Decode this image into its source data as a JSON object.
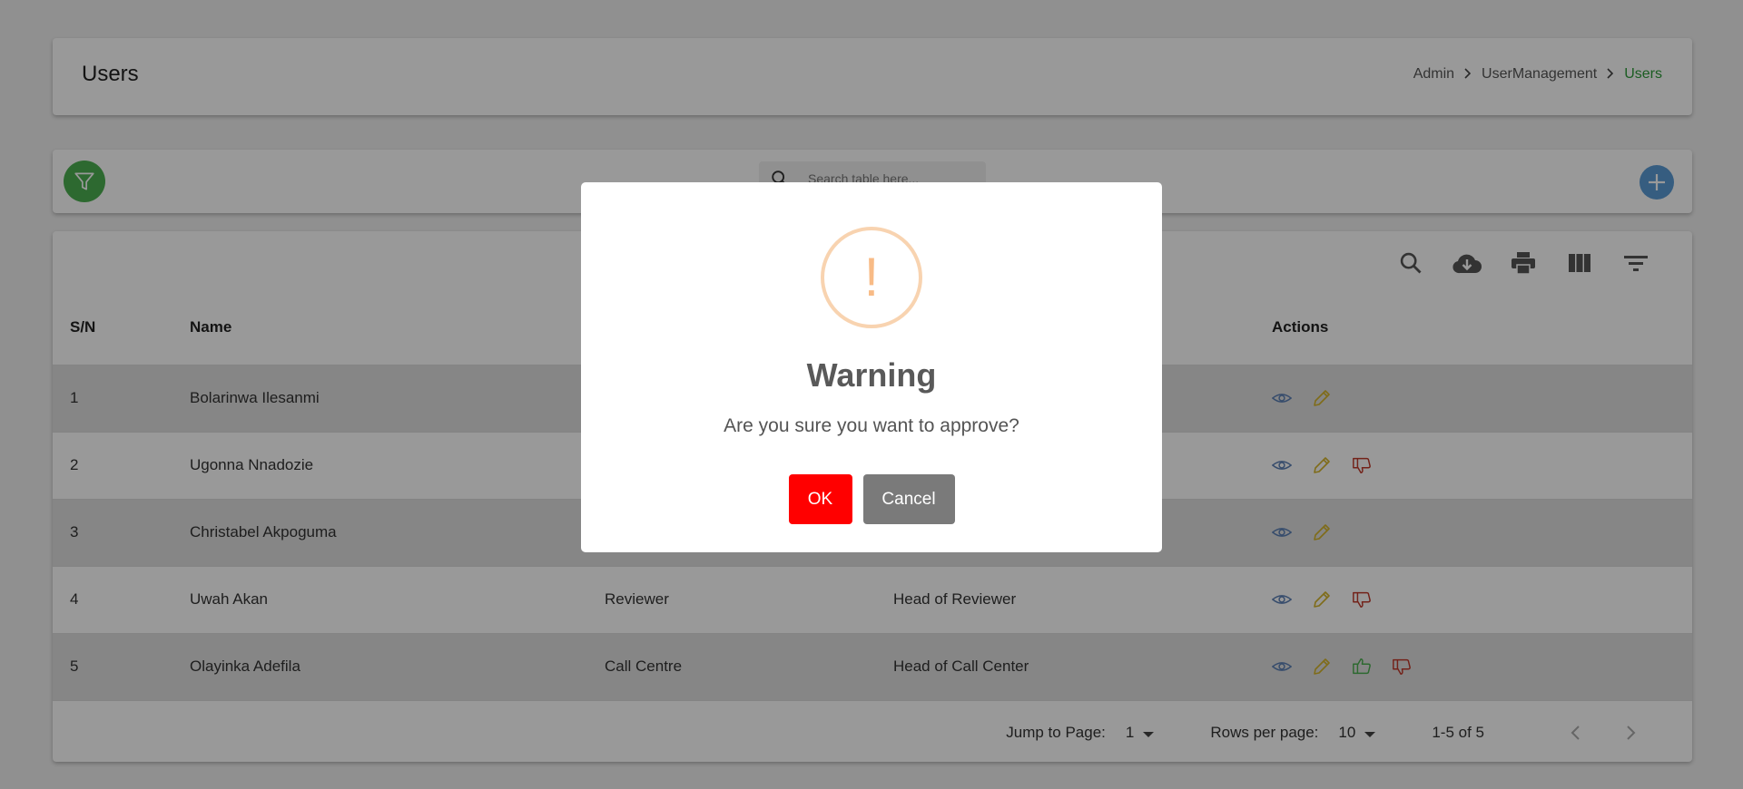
{
  "header": {
    "title": "Users",
    "breadcrumb": [
      "Admin",
      "UserManagement",
      "Users"
    ]
  },
  "toolbar": {
    "search_placeholder": "Search table here...",
    "filter_icon": "filter-icon",
    "add_icon": "plus-icon"
  },
  "table": {
    "tool_icons": [
      "search-icon",
      "cloud-download-icon",
      "print-icon",
      "columns-icon",
      "filter-list-icon"
    ],
    "columns": {
      "sn": "S/N",
      "name": "Name",
      "actions": "Actions"
    },
    "rows": [
      {
        "sn": "1",
        "name": "Bolarinwa Ilesanmi",
        "role": "",
        "designation": "",
        "actions": [
          "view",
          "edit"
        ]
      },
      {
        "sn": "2",
        "name": "Ugonna Nnadozie",
        "role": "",
        "designation": "",
        "actions": [
          "view",
          "edit",
          "disapprove"
        ]
      },
      {
        "sn": "3",
        "name": "Christabel Akpoguma",
        "role": "",
        "designation": "",
        "actions": [
          "view",
          "edit"
        ]
      },
      {
        "sn": "4",
        "name": "Uwah Akan",
        "role": "Reviewer",
        "designation": "Head of Reviewer",
        "actions": [
          "view",
          "edit",
          "disapprove"
        ]
      },
      {
        "sn": "5",
        "name": "Olayinka Adefila",
        "role": "Call Centre",
        "designation": "Head of Call Center",
        "actions": [
          "view",
          "edit",
          "approve",
          "disapprove"
        ]
      }
    ]
  },
  "pager": {
    "jump_label": "Jump to Page:",
    "jump_value": "1",
    "rows_label": "Rows per page:",
    "rows_value": "10",
    "range": "1-5 of 5"
  },
  "modal": {
    "icon": "!",
    "title": "Warning",
    "text": "Are you sure you want to approve?",
    "ok_label": "OK",
    "cancel_label": "Cancel"
  },
  "colors": {
    "accent_green": "#4caf50",
    "breadcrumb_active": "#2e9b3a",
    "ok_button": "#ff0000",
    "cancel_button": "#7a7a7a",
    "warning_icon": "#f8bb86",
    "view_icon": "#5b7fb5",
    "edit_icon": "#d4b52a",
    "approve_icon": "#4caf50",
    "disapprove_icon": "#c0392b"
  }
}
